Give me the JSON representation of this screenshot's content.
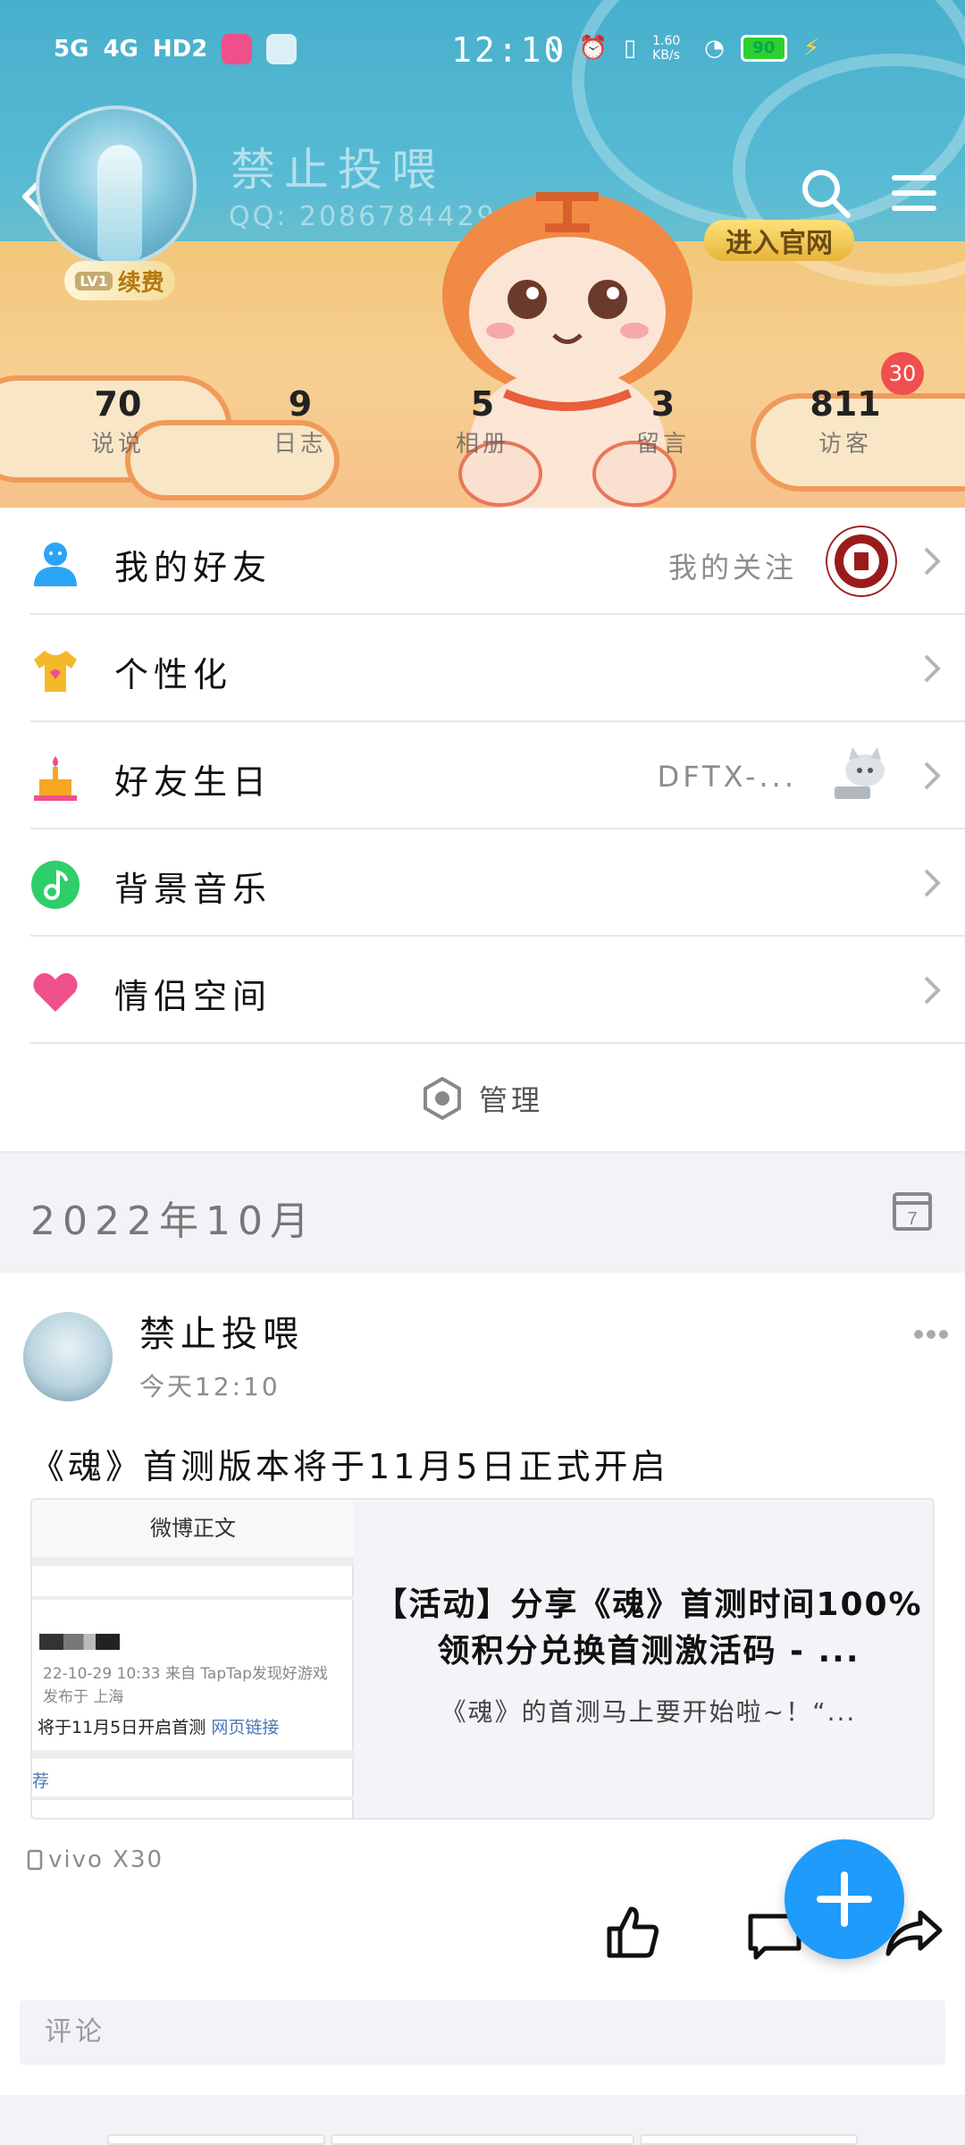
{
  "status_bar": {
    "time": "12:10",
    "network_labels": [
      "5G",
      "4G",
      "HD2"
    ],
    "speed": "1.60 KB/s",
    "battery": "90"
  },
  "profile": {
    "nickname": "禁止投喂",
    "qq": "QQ: 2086784429",
    "vip_level": "LV1",
    "renew_label": "续费",
    "official_site_label": "进入官网"
  },
  "stats": [
    {
      "value": "70",
      "label": "说说"
    },
    {
      "value": "9",
      "label": "日志"
    },
    {
      "value": "5",
      "label": "相册"
    },
    {
      "value": "3",
      "label": "留言"
    },
    {
      "value": "811",
      "label": "访客"
    }
  ],
  "visitor_badge": "30",
  "menu": {
    "friends": {
      "title": "我的好友",
      "sub": "我的关注"
    },
    "personalize": {
      "title": "个性化"
    },
    "birthday": {
      "title": "好友生日",
      "sub": "DFTX-..."
    },
    "music": {
      "title": "背景音乐"
    },
    "couple": {
      "title": "情侣空间"
    },
    "manage": "管理"
  },
  "timeline": {
    "month": "2022年10月"
  },
  "post": {
    "author": "禁止投喂",
    "time": "今天12:10",
    "text": "《魂》首测版本将于11月5日正式开启",
    "card": {
      "thumb_title": "微博正文",
      "thumb_meta": "22-10-29 10:33 来自 TapTap发现好游戏",
      "thumb_loc": "发布于 上海",
      "thumb_body": "将于11月5日开启首测",
      "thumb_link": "网页链接",
      "thumb_rec": "荐",
      "title": "【活动】分享《魂》首测时间100%领积分兑换首测激活码 - ...",
      "desc": "《魂》的首测马上要开始啦~！“..."
    },
    "device": "vivo X30",
    "comment_placeholder": "评论"
  },
  "colors": {
    "accent": "#1e9bfb",
    "badge": "#f04f4f",
    "icon_friends": "#2aa5f5",
    "icon_personalize": "#f5b82a",
    "icon_birthday": "#f5a623",
    "icon_music": "#2ecf6a",
    "icon_couple": "#f0508a"
  }
}
